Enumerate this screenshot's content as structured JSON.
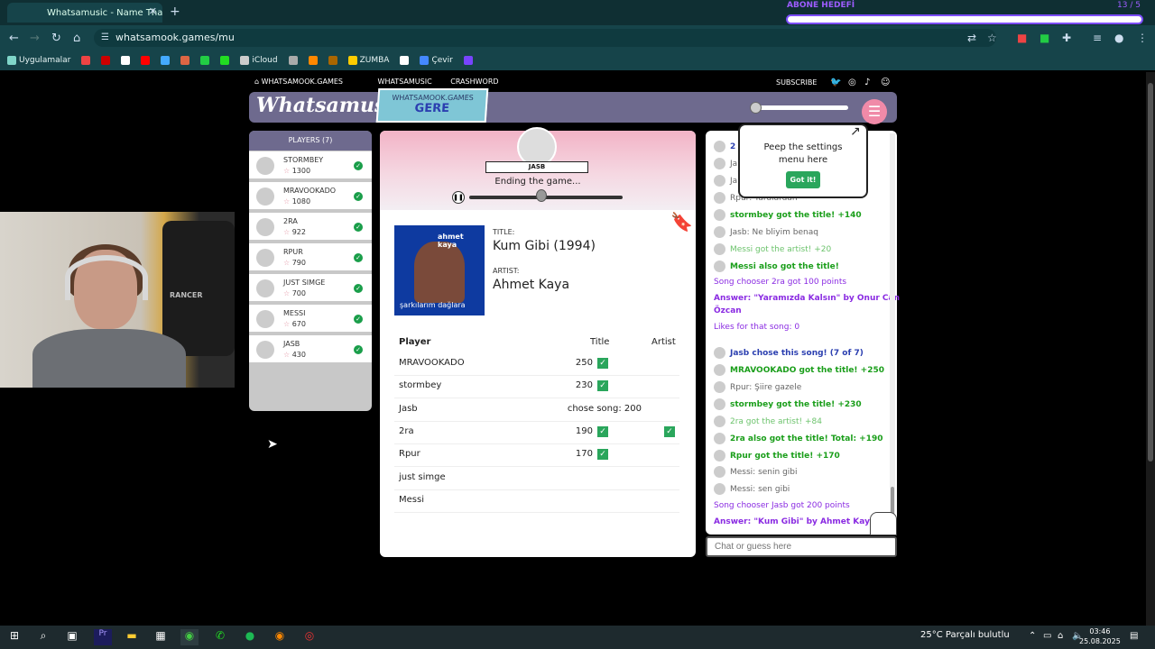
{
  "browser": {
    "tab_title": "Whatsamusic - Name That Tune",
    "url": "whatsamook.games/mu",
    "logo_text": "9",
    "bookmarks": [
      {
        "label": "Uygulamalar",
        "color": "#7fd6c9"
      },
      {
        "label": "",
        "color": "#e44"
      },
      {
        "label": "",
        "color": "#c00"
      },
      {
        "label": "",
        "color": "#fff"
      },
      {
        "label": "",
        "color": "#f00"
      },
      {
        "label": "",
        "color": "#4af"
      },
      {
        "label": "",
        "color": "#d64"
      },
      {
        "label": "",
        "color": "#2c4"
      },
      {
        "label": "",
        "color": "#2d2"
      },
      {
        "label": "iCloud",
        "color": "#ccc"
      },
      {
        "label": "",
        "color": "#aaa"
      },
      {
        "label": "",
        "color": "#f80"
      },
      {
        "label": "",
        "color": "#a60"
      },
      {
        "label": "ZUMBA",
        "color": "#fc0"
      },
      {
        "label": "",
        "color": "#fff"
      },
      {
        "label": "Çevir",
        "color": "#48f"
      },
      {
        "label": "",
        "color": "#74f"
      }
    ]
  },
  "overlay": {
    "abone_label": "ABONE HEDEFİ",
    "abone_count": "13 / 5"
  },
  "site": {
    "nav": [
      "WHATSAMOOK.GAMES",
      "WHATSAMUSIC",
      "CRASHWORD"
    ],
    "subscribe": "SUBSCRIBE",
    "brand": "Whatsamusic",
    "badge_top": "WHATSAMOOK.GAMES",
    "badge_bottom": "GERE"
  },
  "players": {
    "header": "PLAYERS (7)",
    "list": [
      {
        "name": "STORMBEY",
        "score": "1300"
      },
      {
        "name": "MRAVOOKADO",
        "score": "1080"
      },
      {
        "name": "2RA",
        "score": "922"
      },
      {
        "name": "RPUR",
        "score": "790"
      },
      {
        "name": "JUST SIMGE",
        "score": "700"
      },
      {
        "name": "MESSI",
        "score": "670"
      },
      {
        "name": "JASB",
        "score": "430"
      }
    ]
  },
  "game": {
    "chooser": "JASB",
    "status": "Ending the game...",
    "progress": 0.47,
    "cover_artist": "ahmet kaya",
    "cover_album": "şarkılarım dağlara",
    "title_label": "TITLE:",
    "title": "Kum Gibi (1994)",
    "artist_label": "ARTIST:",
    "artist": "Ahmet Kaya",
    "score_headers": {
      "player": "Player",
      "title": "Title",
      "artist": "Artist"
    },
    "scores": [
      {
        "player": "MRAVOOKADO",
        "title": "250",
        "title_check": true,
        "artist_check": false
      },
      {
        "player": "stormbey",
        "title": "230",
        "title_check": true,
        "artist_check": false
      },
      {
        "player": "Jasb",
        "title": "chose song: 200",
        "title_check": false,
        "artist_check": false
      },
      {
        "player": "2ra",
        "title": "190",
        "title_check": true,
        "artist_check": true
      },
      {
        "player": "Rpur",
        "title": "170",
        "title_check": true,
        "artist_check": false
      },
      {
        "player": "just simge",
        "title": "",
        "title_check": false,
        "artist_check": false
      },
      {
        "player": "Messi",
        "title": "",
        "title_check": false,
        "artist_check": false
      }
    ]
  },
  "tooltip": {
    "text": "Peep the settings menu here",
    "button": "Got it!"
  },
  "chat": {
    "placeholder": "Chat or guess here",
    "messages": [
      {
        "text": "2",
        "style": "b",
        "avatar": true
      },
      {
        "text": "Ja",
        "style": "m",
        "avatar": true
      },
      {
        "text": "Ja",
        "style": "m",
        "avatar": true
      },
      {
        "text": "Rpur: Yaralardan",
        "style": "m",
        "avatar": true
      },
      {
        "text": "stormbey got the title! +140",
        "style": "g",
        "avatar": true
      },
      {
        "text": "Jasb: Ne bliyim benaq",
        "style": "m",
        "avatar": true
      },
      {
        "text": "Messi got the artist! +20",
        "style": "gl",
        "avatar": true
      },
      {
        "text": "Messi also got the title!",
        "style": "g",
        "avatar": true
      },
      {
        "text": "Song chooser 2ra got 100 points",
        "style": "p",
        "avatar": false
      },
      {
        "text": "Answer: \"Yaramızda Kalsın\" by Onur Can",
        "style": "pb",
        "avatar": false
      },
      {
        "text": "Özcan",
        "style": "pb",
        "avatar": false
      },
      {
        "text": "Likes for that song: 0",
        "style": "p",
        "avatar": false
      },
      {
        "text": "Jasb chose this song! (7 of 7)",
        "style": "b",
        "avatar": true
      },
      {
        "text": "MRAVOOKADO got the title! +250",
        "style": "g",
        "avatar": true
      },
      {
        "text": "Rpur: Şiire gazele",
        "style": "m",
        "avatar": true
      },
      {
        "text": "stormbey got the title! +230",
        "style": "g",
        "avatar": true
      },
      {
        "text": "2ra got the artist! +84",
        "style": "gl",
        "avatar": true
      },
      {
        "text": "2ra also got the title! Total: +190",
        "style": "g",
        "avatar": true
      },
      {
        "text": "Rpur got the title! +170",
        "style": "g",
        "avatar": true
      },
      {
        "text": "Messi: senin gibi",
        "style": "m",
        "avatar": true
      },
      {
        "text": "Messi: sen gibi",
        "style": "m",
        "avatar": true
      },
      {
        "text": "Song chooser Jasb got 200 points",
        "style": "p",
        "avatar": false
      },
      {
        "text": "Answer: \"Kum Gibi\" by Ahmet Kaya",
        "style": "pb",
        "avatar": false
      }
    ]
  },
  "webcam": {
    "chair_label": "RANCER"
  },
  "taskbar": {
    "weather": "25°C  Parçalı bulutlu",
    "time": "03:46",
    "date": "25.08.2025"
  }
}
